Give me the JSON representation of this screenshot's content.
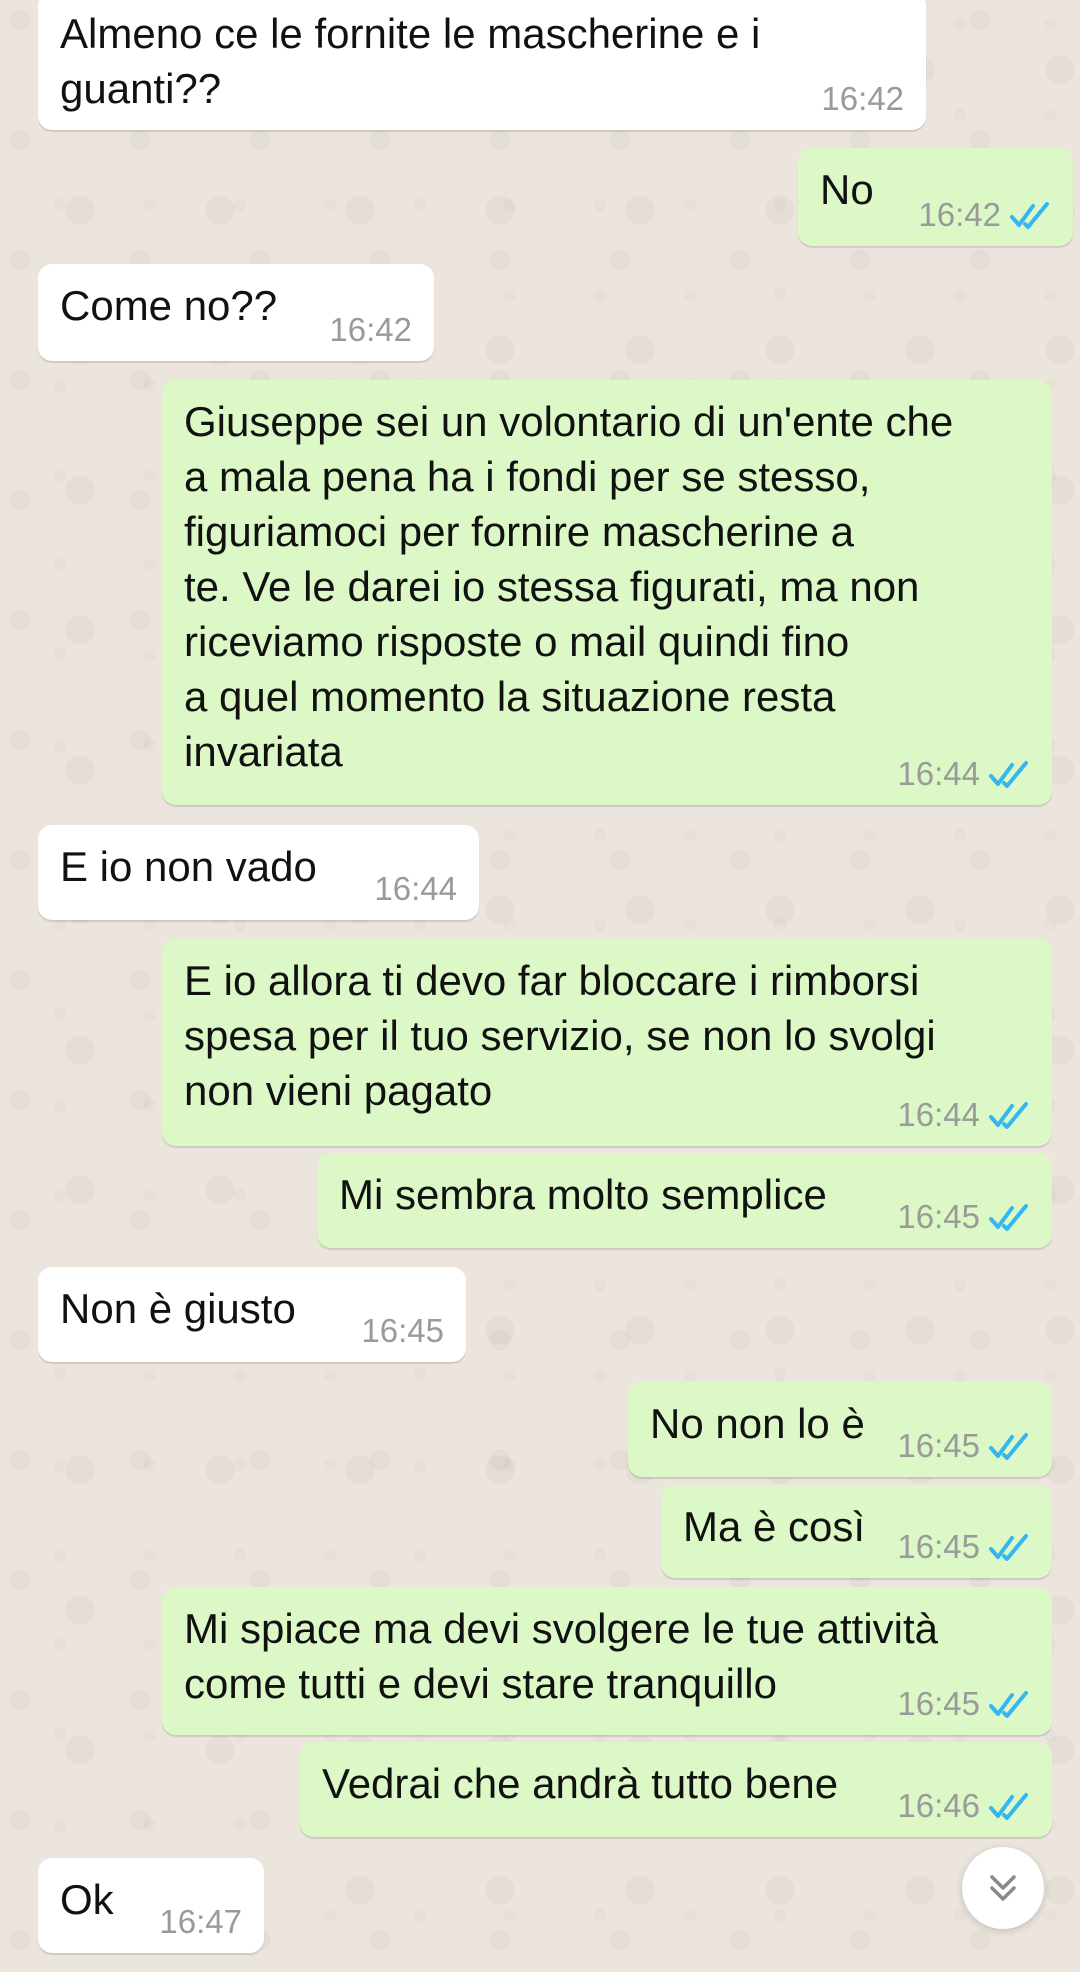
{
  "messages": [
    {
      "text": "Almeno ce le fornite le mascherine e i\nguanti??",
      "time": "16:42"
    },
    {
      "text": "No",
      "time": "16:42"
    },
    {
      "text": "Come no??",
      "time": "16:42"
    },
    {
      "text": "Giuseppe sei un volontario di un'ente che\na mala pena ha i fondi per se stesso,\nfiguriamoci per fornire mascherine a\nte. Ve le darei io stessa figurati, ma non\nriceviamo risposte o mail quindi fino\na quel momento la situazione resta\ninvariata",
      "time": "16:44"
    },
    {
      "text": "E io non vado",
      "time": "16:44"
    },
    {
      "text": "E io allora ti devo far bloccare i rimborsi\nspesa per il tuo servizio, se non lo svolgi\nnon vieni pagato",
      "time": "16:44"
    },
    {
      "text": "Mi sembra molto semplice",
      "time": "16:45"
    },
    {
      "text": "Non è giusto",
      "time": "16:45"
    },
    {
      "text": "No non lo è",
      "time": "16:45"
    },
    {
      "text": "Ma è così",
      "time": "16:45"
    },
    {
      "text": "Mi spiace ma devi svolgere le tue attività\ncome tutti e devi stare tranquillo",
      "time": "16:45"
    },
    {
      "text": "Vedrai che andrà tutto bene",
      "time": "16:46"
    },
    {
      "text": "Ok",
      "time": "16:47"
    }
  ],
  "icons": {
    "read_receipt": "double-check-icon",
    "scroll_down": "chevron-double-down-icon"
  },
  "colors": {
    "chat_background": "#ece5dd",
    "incoming_bubble": "#ffffff",
    "outgoing_bubble": "#dcf8c6",
    "read_receipt": "#34b7f1",
    "timestamp": "#9a9a9a"
  }
}
